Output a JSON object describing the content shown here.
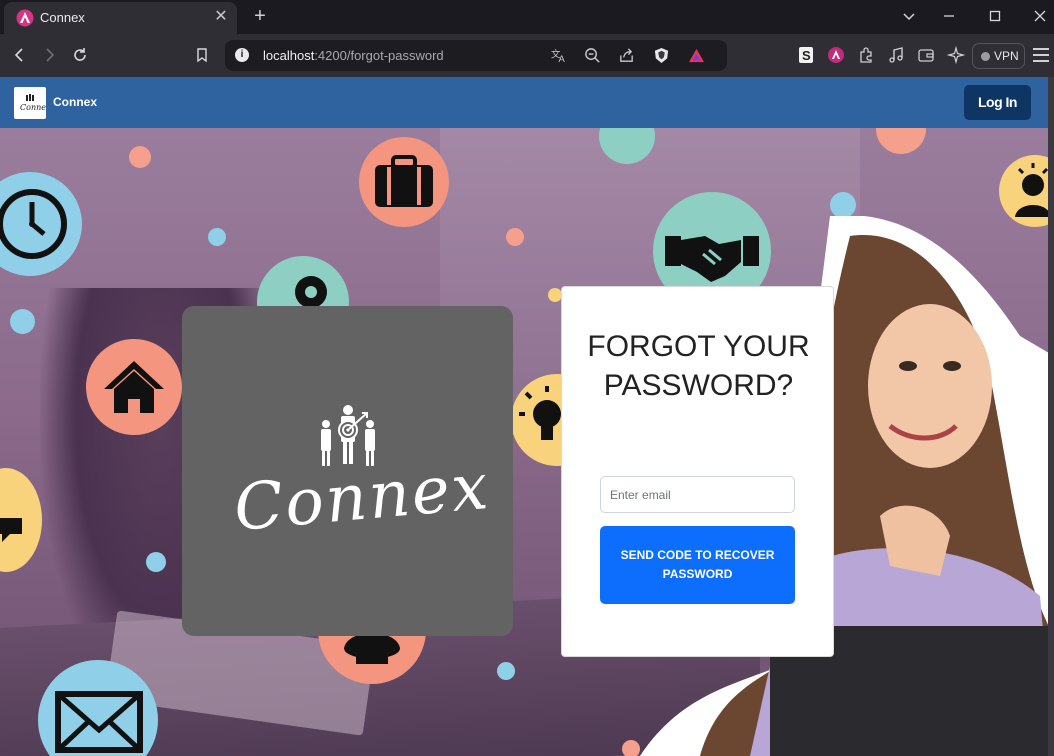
{
  "browser": {
    "tab_title": "Connex",
    "url_host": "localhost",
    "url_rest": ":4200/forgot-password",
    "vpn_label": "VPN",
    "tab_close_glyph": "✕",
    "new_tab_glyph": "+"
  },
  "navbar": {
    "brand_name": "Connex",
    "login_label": "Log In",
    "background": "#2f63a0",
    "login_background": "#0e3564"
  },
  "logo_card": {
    "wordmark": "Connex"
  },
  "form": {
    "title": "FORGOT YOUR PASSWORD?",
    "email_placeholder": "Enter email",
    "email_value": "",
    "submit_label": "SEND CODE TO RECOVER PASSWORD",
    "accent": "#0d6efd"
  },
  "icons": [
    "connex-favicon",
    "back-icon",
    "forward-icon",
    "reload-icon",
    "bookmark-icon",
    "site-info-icon",
    "translate-icon",
    "zoom-out-icon",
    "share-icon",
    "brave-shields-icon",
    "brave-rewards-icon",
    "extension-s-icon",
    "connex-extension-icon",
    "extensions-icon",
    "music-icon",
    "wallet-icon",
    "leo-ai-icon",
    "menu-icon",
    "clock-icon",
    "briefcase-icon",
    "handshake-icon",
    "idea-person-icon",
    "home-icon",
    "lightbulb-icon",
    "envelope-icon",
    "chat-icon"
  ]
}
